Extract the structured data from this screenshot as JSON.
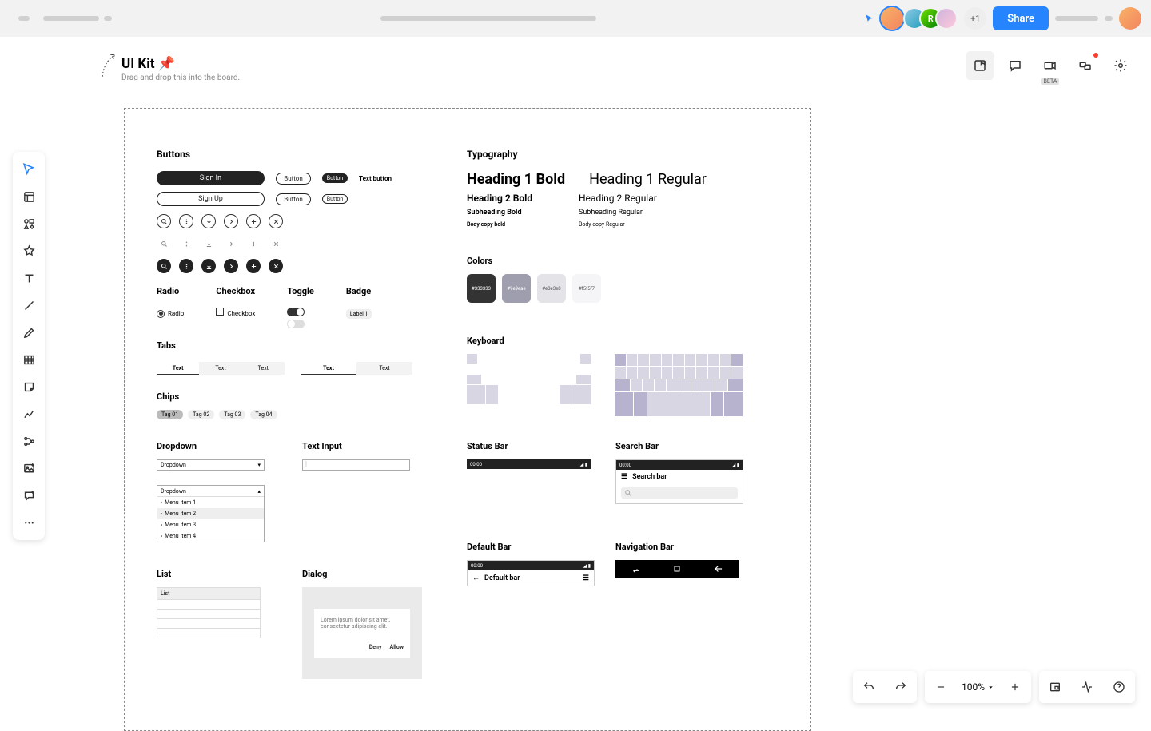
{
  "topbar": {
    "plus_count": "+1",
    "share": "Share",
    "avatar_initial": "R"
  },
  "right_tools": {
    "beta": "BETA"
  },
  "zoom": {
    "level": "100%"
  },
  "frame": {
    "title": "UI Kit",
    "pin": "📌",
    "subtitle": "Drag and drop this into the board."
  },
  "sections": {
    "buttons": {
      "heading": "Buttons",
      "sign_in": "Sign In",
      "sign_up": "Sign Up",
      "button": "Button",
      "text_button": "Text button"
    },
    "controls": {
      "radio_h": "Radio",
      "radio": "Radio",
      "checkbox_h": "Checkbox",
      "checkbox": "Checkbox",
      "toggle_h": "Toggle",
      "badge_h": "Badge",
      "badge": "Label 1"
    },
    "tabs": {
      "heading": "Tabs",
      "text": "Text"
    },
    "chips": {
      "heading": "Chips",
      "items": [
        "Tag 01",
        "Tag 02",
        "Tag 03",
        "Tag 04"
      ]
    },
    "dropdown": {
      "heading": "Dropdown",
      "label": "Dropdown",
      "items": [
        "Menu Item 1",
        "Menu Item 2",
        "Menu Item 3",
        "Menu Item 4"
      ]
    },
    "text_input": {
      "heading": "Text Input",
      "placeholder": "|"
    },
    "list": {
      "heading": "List",
      "label": "List"
    },
    "dialog": {
      "heading": "Dialog",
      "body": "Lorem ipsum dolor sit amet, consectetur adipiscing elit.",
      "deny": "Deny",
      "allow": "Allow"
    },
    "typography": {
      "heading": "Typography",
      "h1b": "Heading 1 Bold",
      "h1r": "Heading 1 Regular",
      "h2b": "Heading 2 Bold",
      "h2r": "Heading 2 Regular",
      "shb": "Subheading Bold",
      "shr": "Subheading Regular",
      "bcb": "Body copy bold",
      "bcr": "Body copy Regular"
    },
    "colors": {
      "heading": "Colors",
      "swatches": [
        {
          "hex": "#333333",
          "label": "#333333",
          "text": "#fff"
        },
        {
          "hex": "#9e9eae",
          "label": "#9e9eae",
          "text": "#fff"
        },
        {
          "hex": "#e3e3e8",
          "label": "#e3e3e8",
          "text": "#555"
        },
        {
          "hex": "#f5f5f7",
          "label": "#f5f5f7",
          "text": "#555"
        }
      ]
    },
    "keyboard": {
      "heading": "Keyboard"
    },
    "status_bar": {
      "heading": "Status Bar",
      "time": "00:00"
    },
    "search_bar": {
      "heading": "Search Bar",
      "time": "00:00",
      "title": "Search bar"
    },
    "default_bar": {
      "heading": "Default Bar",
      "time": "00:00",
      "title": "Default bar"
    },
    "nav_bar": {
      "heading": "Navigation Bar"
    }
  }
}
